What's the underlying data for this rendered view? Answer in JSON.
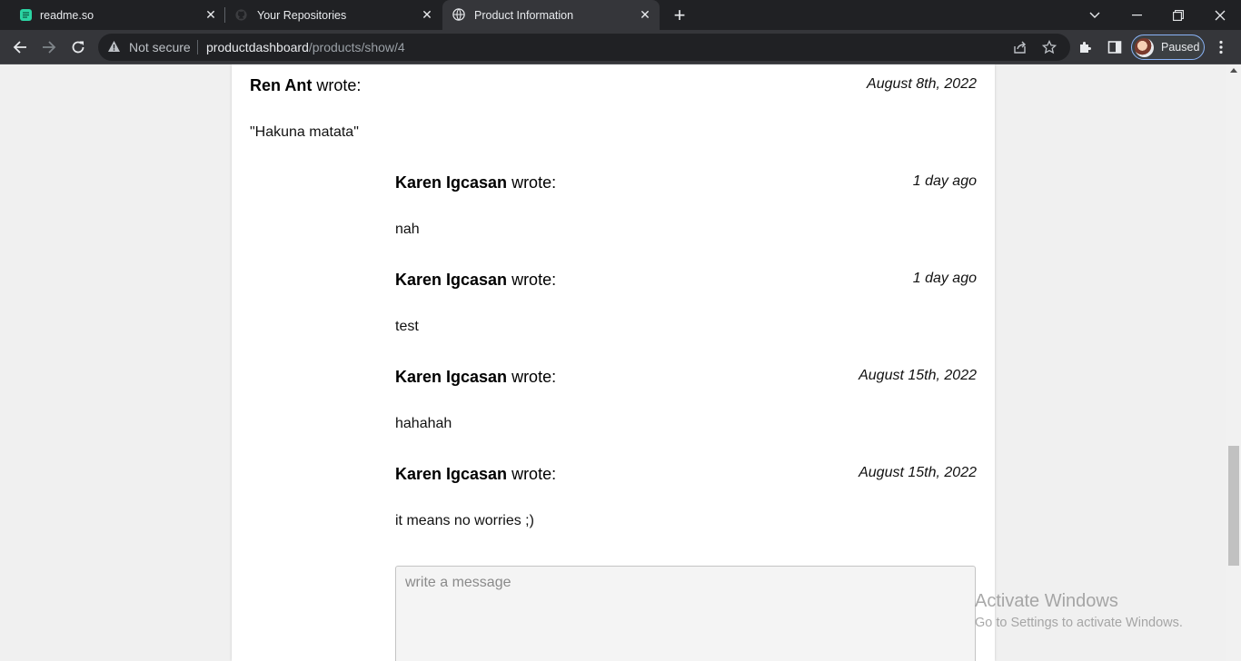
{
  "browser": {
    "tabs": [
      {
        "title": "readme.so",
        "icon": "readme-icon",
        "active": false
      },
      {
        "title": "Your Repositories",
        "icon": "github-icon",
        "active": false
      },
      {
        "title": "Product Information",
        "icon": "globe-icon",
        "active": true
      }
    ],
    "address": {
      "security_label": "Not secure",
      "host": "productdashboard",
      "path": "/products/show/4"
    },
    "profile_status": "Paused"
  },
  "thread": {
    "wrote_label": " wrote:",
    "root": {
      "author": "Ren Ant",
      "date": "August 8th, 2022",
      "text": "\"Hakuna matata\""
    },
    "replies": [
      {
        "author": "Karen Igcasan",
        "date": "1 day ago",
        "text": "nah"
      },
      {
        "author": "Karen Igcasan",
        "date": "1 day ago",
        "text": "test"
      },
      {
        "author": "Karen Igcasan",
        "date": "August 15th, 2022",
        "text": "hahahah"
      },
      {
        "author": "Karen Igcasan",
        "date": "August 15th, 2022",
        "text": "it means no worries ;)"
      }
    ],
    "reply_placeholder": "write a message"
  },
  "watermark": {
    "title": "Activate Windows",
    "subtitle": "Go to Settings to activate Windows."
  }
}
